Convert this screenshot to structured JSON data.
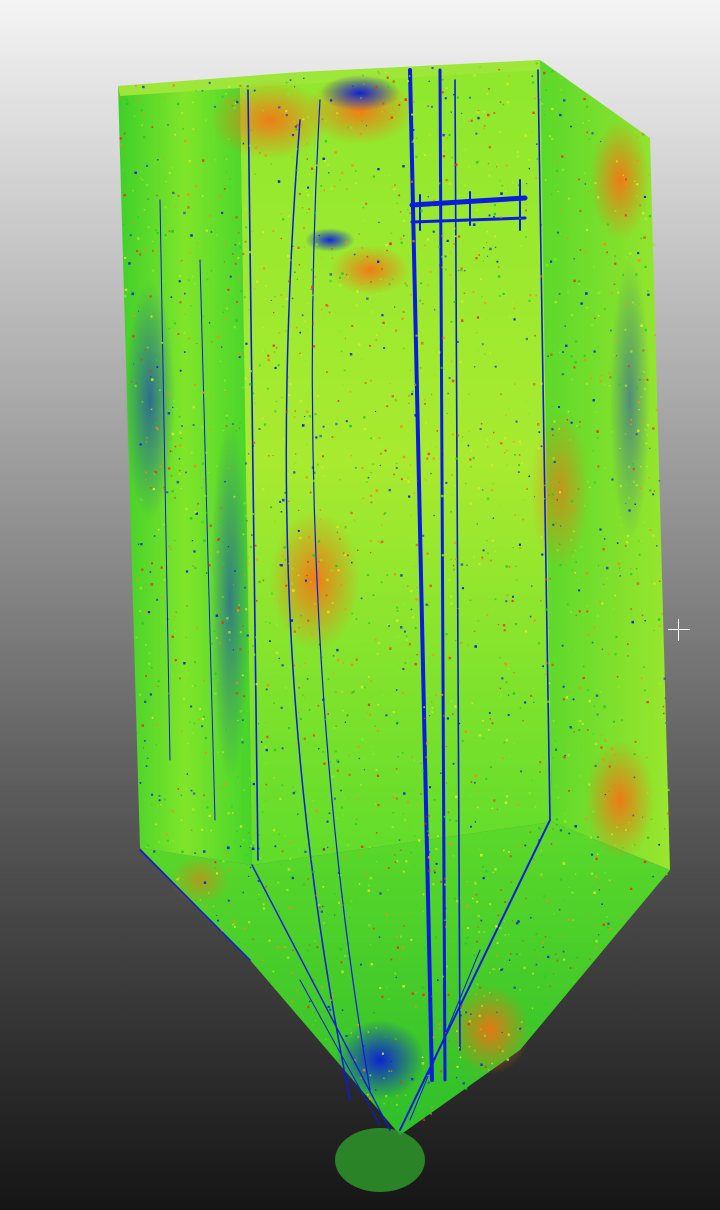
{
  "viewer": {
    "background_top": "#f4f4f4",
    "background_bottom": "#151515"
  },
  "point_cloud": {
    "object": "hopper-silo",
    "color_scale": [
      "#0022dd",
      "#22cc22",
      "#88ee22",
      "#ddee22",
      "#ff8811",
      "#ee3311"
    ],
    "dominant_color": "#55dd22"
  },
  "cursor": {
    "icon": "crosshair-icon"
  }
}
